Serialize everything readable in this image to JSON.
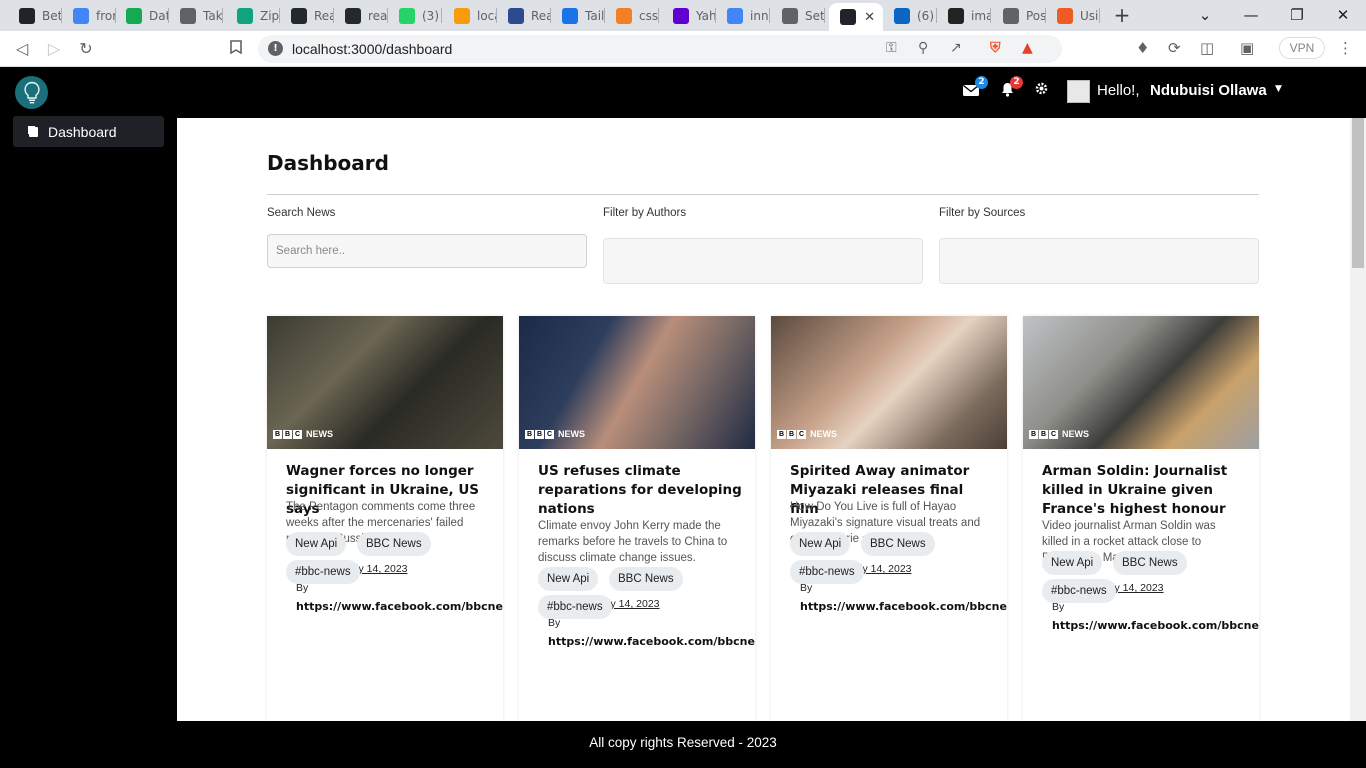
{
  "browser": {
    "tabs": [
      {
        "label": "Bet",
        "icon": "react-icon",
        "color": "#20232a"
      },
      {
        "label": "fror",
        "icon": "google-icon",
        "color": "#4285f4"
      },
      {
        "label": "Dat",
        "icon": "mongodb-icon",
        "color": "#13aa52"
      },
      {
        "label": "Take",
        "icon": "globe-icon",
        "color": "#5f6368"
      },
      {
        "label": "Zip",
        "icon": "chatgpt-icon",
        "color": "#10a37f"
      },
      {
        "label": "Rea",
        "icon": "github-icon",
        "color": "#24292e"
      },
      {
        "label": "reac",
        "icon": "github-icon",
        "color": "#24292e"
      },
      {
        "label": "(3) \\",
        "icon": "whatsapp-icon",
        "color": "#25d366"
      },
      {
        "label": "loca",
        "icon": "phpmyadmin-icon",
        "color": "#f89c0e"
      },
      {
        "label": "Rea",
        "icon": "reactive-icon",
        "color": "#2e4a8f"
      },
      {
        "label": "Tail",
        "icon": "play-icon",
        "color": "#1a73e8"
      },
      {
        "label": "css",
        "icon": "stackoverflow-icon",
        "color": "#f48024"
      },
      {
        "label": "Yah",
        "icon": "yahoo-icon",
        "color": "#6001d2"
      },
      {
        "label": "inne",
        "icon": "google-icon",
        "color": "#4285f4"
      },
      {
        "label": "Sett",
        "icon": "gear-icon",
        "color": "#5f6368"
      },
      {
        "label": "",
        "icon": "react-icon",
        "color": "#20232a",
        "active": true
      },
      {
        "label": "(6)",
        "icon": "linkedin-icon",
        "color": "#0a66c2"
      },
      {
        "label": "ima",
        "icon": "bing-icon",
        "color": "#222222"
      },
      {
        "label": "Pos",
        "icon": "globe-icon",
        "color": "#5f6368"
      },
      {
        "label": "Usi",
        "icon": "postman-icon",
        "color": "#ef5b25"
      }
    ],
    "url": "localhost:3000/dashboard",
    "vpn_label": "VPN"
  },
  "header": {
    "mail_count": "2",
    "notif_count": "2",
    "hello": "Hello!,",
    "username": "Ndubuisi Ollawa",
    "badge_colors": {
      "mail": "#1e88e5",
      "notif": "#e53935"
    }
  },
  "sidebar": {
    "items": [
      {
        "label": "Dashboard"
      }
    ]
  },
  "main": {
    "title": "Dashboard",
    "search_label": "Search News",
    "search_placeholder": "Search here..",
    "authors_label": "Filter by Authors",
    "sources_label": "Filter by Sources"
  },
  "articles": [
    {
      "title": "Wagner forces no longer significant in Ukraine, US says",
      "description": "The Pentagon comments come three weeks after the mercenaries' failed mutiny in Russia.",
      "published_label": "Published",
      "date": "July 14, 2023",
      "by_label": "By",
      "author": "https://www.facebook.com/bbcnews",
      "tags": [
        "New Api",
        "BBC News",
        "#bbc-news"
      ]
    },
    {
      "title": "US refuses climate reparations for developing nations",
      "description": "Climate envoy John Kerry made the remarks before he travels to China to discuss climate change issues.",
      "published_label": "Published",
      "date": "July 14, 2023",
      "by_label": "By",
      "author": "https://www.facebook.com/bbcnews",
      "tags": [
        "New Api",
        "BBC News",
        "#bbc-news"
      ]
    },
    {
      "title": "Spirited Away animator Miyazaki releases final film",
      "description": "How Do You Live is full of Hayao Miyazaki's signature visual treats and cute yet eerie creatures.",
      "published_label": "Published",
      "date": "July 14, 2023",
      "by_label": "By",
      "author": "https://www.facebook.com/bbcnews",
      "tags": [
        "New Api",
        "BBC News",
        "#bbc-news"
      ]
    },
    {
      "title": "Arman Soldin: Journalist killed in Ukraine given France's highest honour",
      "description": "Video journalist Arman Soldin was killed in a rocket attack close to Bakhmut in May.",
      "published_label": "Published",
      "date": "July 14, 2023",
      "by_label": "By",
      "author": "https://www.facebook.com/bbcnews",
      "tags": [
        "New Api",
        "BBC News",
        "#bbc-news"
      ]
    }
  ],
  "image_badge": {
    "letters": [
      "B",
      "B",
      "C"
    ],
    "word": "NEWS"
  },
  "footer": {
    "text": "All copy rights Reserved - 2023"
  }
}
